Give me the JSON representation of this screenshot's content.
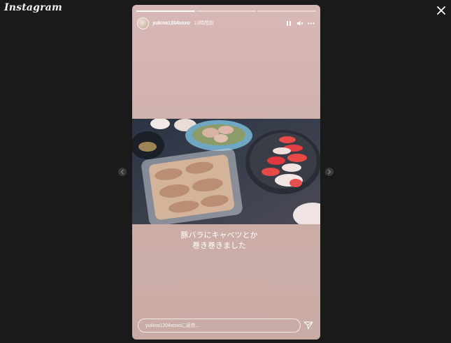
{
  "brand": {
    "logo_text": "Instagram"
  },
  "story": {
    "username": "yukina1204xoxo",
    "time_ago": "13時間前",
    "progress": {
      "segments": 3,
      "completed": 1
    },
    "photo": {
      "icon": "food-photo",
      "description_shown": ""
    },
    "caption_lines": [
      "豚バラにキャベツとか",
      "巻き巻きました"
    ],
    "reply": {
      "placeholder": "yukina1204xoxoに返信..."
    }
  },
  "icons": {
    "close": "close-icon",
    "pause": "pause-icon",
    "mute": "speaker-icon",
    "more": "more-icon",
    "prev": "chevron-left-icon",
    "next": "chevron-right-icon",
    "send": "send-icon"
  },
  "colors": {
    "background": "#1a1a1a",
    "story_bg": "#d8b8b7"
  }
}
